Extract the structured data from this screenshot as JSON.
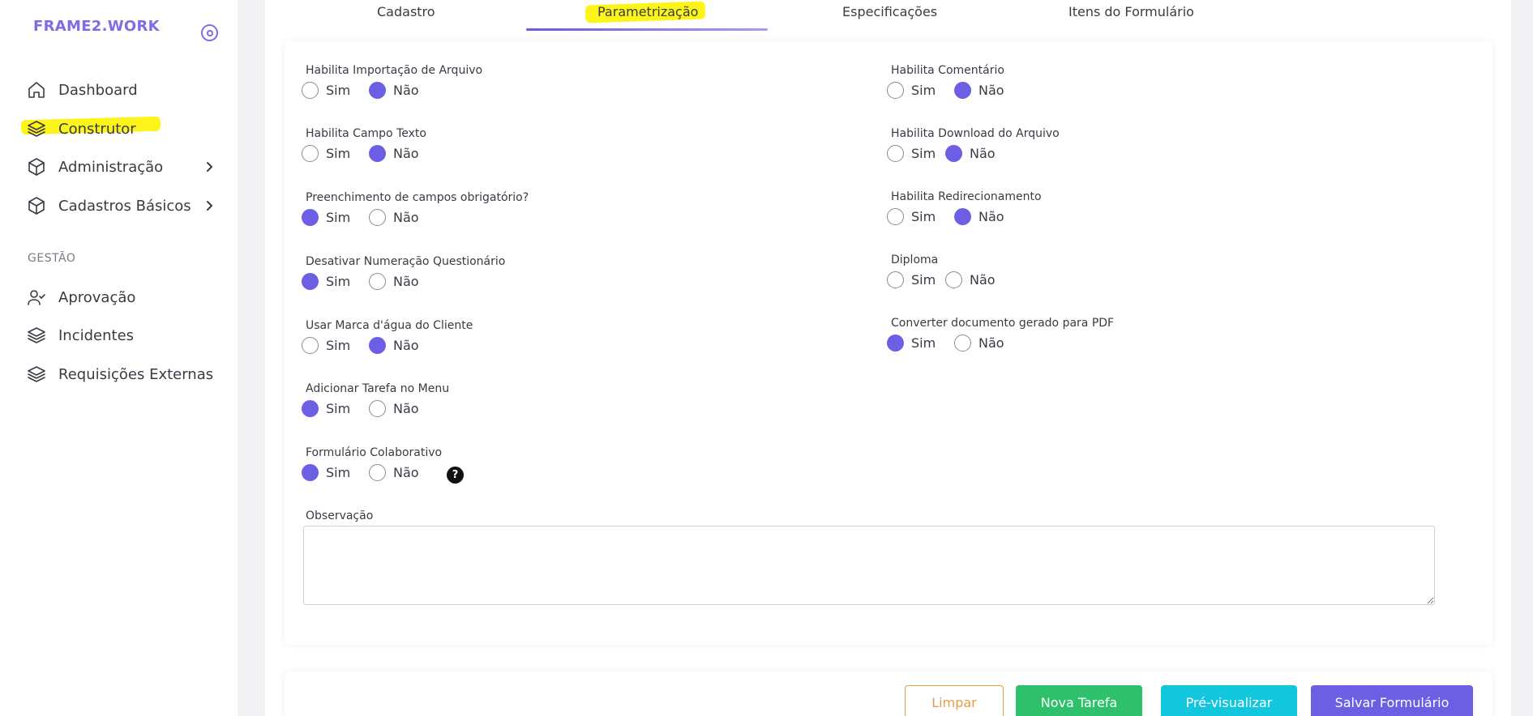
{
  "brand": "FRAME2.WORK",
  "sidebar": {
    "items": [
      {
        "label": "Dashboard"
      },
      {
        "label": "Construtor"
      },
      {
        "label": "Administração"
      },
      {
        "label": "Cadastros Básicos"
      }
    ],
    "section_label": "GESTÃO",
    "gestao_items": [
      {
        "label": "Aprovação"
      },
      {
        "label": "Incidentes"
      },
      {
        "label": "Requisições Externas"
      }
    ]
  },
  "tabs": [
    {
      "label": "Cadastro"
    },
    {
      "label": "Parametrização",
      "active": true
    },
    {
      "label": "Especificações"
    },
    {
      "label": "Itens do Formulário"
    }
  ],
  "options": {
    "yes": "Sim",
    "no": "Não"
  },
  "left_fields": [
    {
      "label": "Habilita Importação de Arquivo",
      "value": "Não"
    },
    {
      "label": "Habilita Campo Texto",
      "value": "Não"
    },
    {
      "label": "Preenchimento de campos obrigatório?",
      "value": "Sim"
    },
    {
      "label": "Desativar Numeração Questionário",
      "value": "Sim"
    },
    {
      "label": "Usar Marca d'água do Cliente",
      "value": "Não"
    },
    {
      "label": "Adicionar Tarefa no Menu",
      "value": "Sim"
    },
    {
      "label": "Formulário Colaborativo",
      "value": "Sim"
    }
  ],
  "right_fields": [
    {
      "label": "Habilita Comentário",
      "value": "Não"
    },
    {
      "label": "Habilita Download do Arquivo",
      "value": "Não"
    },
    {
      "label": "Habilita Redirecionamento",
      "value": "Não"
    },
    {
      "label": "Diploma",
      "value": ""
    },
    {
      "label": "Converter documento gerado para PDF",
      "value": "Sim"
    }
  ],
  "help_glyph": "?",
  "observacao": {
    "label": "Observação",
    "value": ""
  },
  "buttons": {
    "limpar": "Limpar",
    "nova_tarefa": "Nova Tarefa",
    "pre_visualizar": "Pré-visualizar",
    "salvar": "Salvar Formulário"
  },
  "colors": {
    "accent": "#6c5fe3",
    "highlight": "#fdf51a",
    "success": "#2ec06b",
    "info": "#12c7dd",
    "warning": "#e89a4a"
  }
}
